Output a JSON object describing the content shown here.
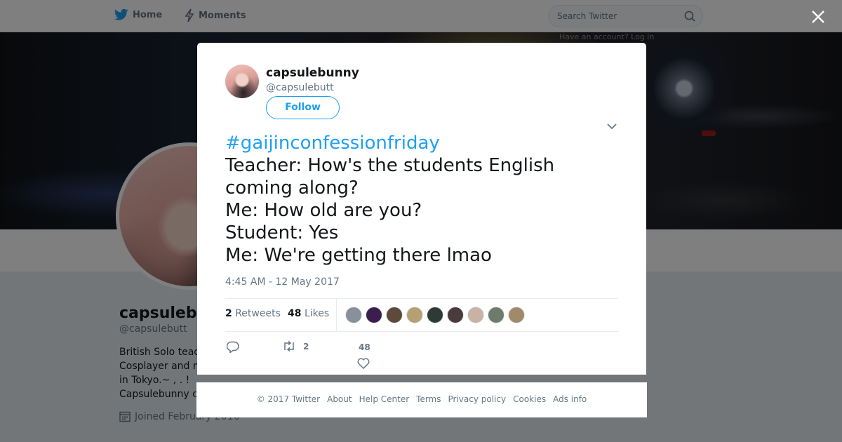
{
  "topbar": {
    "home_label": "Home",
    "moments_label": "Moments",
    "search_placeholder": "Search Twitter",
    "faint_text": "Have an account? Log in"
  },
  "profile": {
    "name": "capsulebunny",
    "handle": "@capsulebutt",
    "bio_lines": [
      "British Solo teac",
      "Cosplayer and m",
      "in Tokyo.~ , . !",
      "Capsulebunny c"
    ],
    "joined": "Joined February 2016"
  },
  "tweet": {
    "author_name": "capsulebunny",
    "author_handle": "@capsulebutt",
    "follow_label": "Follow",
    "hashtag": "#gaijinconfessionfriday",
    "lines": [
      "Teacher: How's the students English",
      "coming along?",
      "Me: How old are you?",
      "Student: Yes",
      "Me: We're getting there lmao"
    ],
    "timestamp": "4:45 AM - 12 May 2017",
    "retweets_count": "2",
    "retweets_label": "Retweets",
    "likes_count": "48",
    "likes_label": "Likes",
    "retweet_action_count": "2",
    "like_action_count": "48"
  },
  "liker_colors": [
    "#8a9099",
    "#3a1f4e",
    "#5d4a3a",
    "#b5a074",
    "#2e3a33",
    "#4a3b3c",
    "#c9b2a4",
    "#6f7b6a",
    "#a08a6b"
  ],
  "footer": {
    "links": [
      "© 2017 Twitter",
      "About",
      "Help Center",
      "Terms",
      "Privacy policy",
      "Cookies",
      "Ads info"
    ]
  },
  "colors": {
    "accent": "#1da1f2",
    "text": "#14171a",
    "muted": "#657786"
  }
}
